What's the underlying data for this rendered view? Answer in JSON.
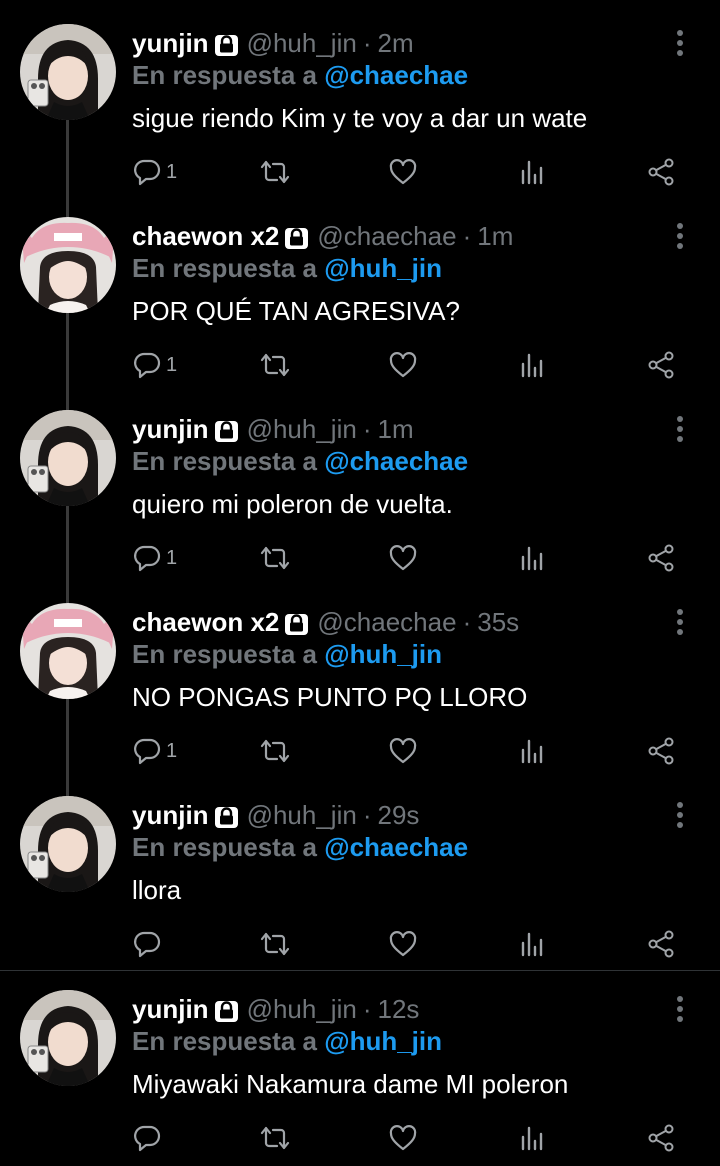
{
  "tweets": [
    {
      "name": "yunjin",
      "handle": "@huh_jin",
      "time": "2m",
      "reply_prefix": "En respuesta a",
      "reply_to": "@chaechae",
      "text": "sigue riendo Kim y te voy a dar un wate",
      "reply_count": "1",
      "avatar": "yunjin"
    },
    {
      "name": "chaewon x2",
      "handle": "@chaechae",
      "time": "1m",
      "reply_prefix": "En respuesta a",
      "reply_to": "@huh_jin",
      "text": "POR QUÉ TAN AGRESIVA?",
      "reply_count": "1",
      "avatar": "chaewon"
    },
    {
      "name": "yunjin",
      "handle": "@huh_jin",
      "time": "1m",
      "reply_prefix": "En respuesta a",
      "reply_to": "@chaechae",
      "text": "quiero mi poleron de vuelta.",
      "reply_count": "1",
      "avatar": "yunjin"
    },
    {
      "name": "chaewon x2",
      "handle": "@chaechae",
      "time": "35s",
      "reply_prefix": "En respuesta a",
      "reply_to": "@huh_jin",
      "text": "NO PONGAS PUNTO PQ LLORO",
      "reply_count": "1",
      "avatar": "chaewon"
    },
    {
      "name": "yunjin",
      "handle": "@huh_jin",
      "time": "29s",
      "reply_prefix": "En respuesta a",
      "reply_to": "@chaechae",
      "text": "llora",
      "reply_count": "",
      "avatar": "yunjin"
    },
    {
      "name": "yunjin",
      "handle": "@huh_jin",
      "time": "12s",
      "reply_prefix": "En respuesta a",
      "reply_to": "@huh_jin",
      "text": "Miyawaki Nakamura dame MI poleron",
      "reply_count": "",
      "avatar": "yunjin"
    }
  ],
  "separator": "·",
  "icons": {
    "lock": "lock-icon",
    "more": "more-vertical-icon",
    "reply": "reply-icon",
    "retweet": "retweet-icon",
    "like": "heart-icon",
    "stats": "stats-icon",
    "share": "share-icon"
  },
  "colors": {
    "background": "#000000",
    "text": "#ffffff",
    "muted": "#71767b",
    "link": "#1d9bf0",
    "thread_line": "#3a3a3a"
  }
}
